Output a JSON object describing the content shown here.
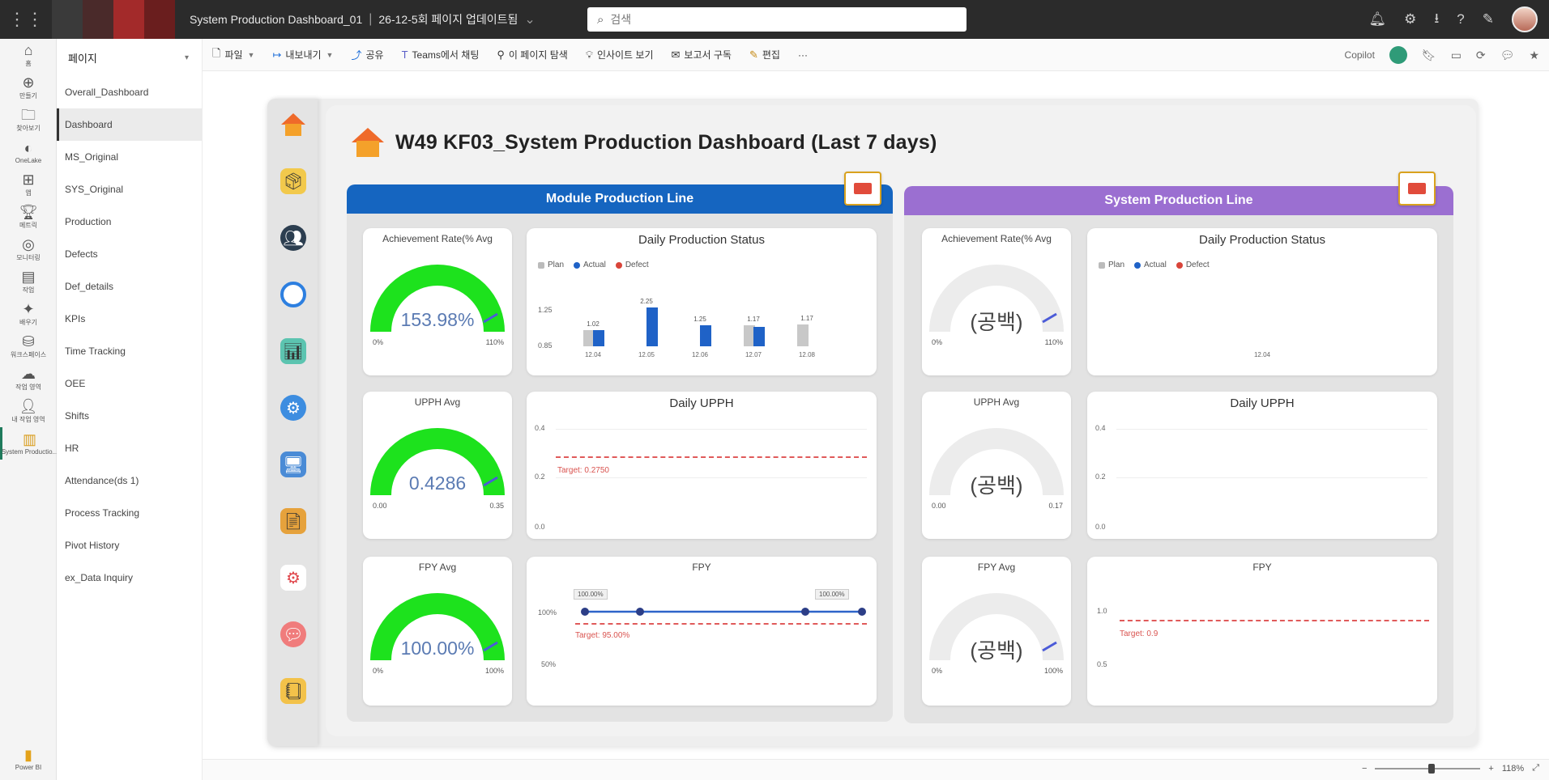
{
  "titlebar": {
    "app_title": "System Production Dashboard_01",
    "crumb": "26-12-5회 페이지 업데이트됨",
    "search_placeholder": "검색"
  },
  "rail": {
    "items": [
      {
        "label": "홈",
        "icon": "home-icon"
      },
      {
        "label": "만들기",
        "icon": "create-icon"
      },
      {
        "label": "찾아보기",
        "icon": "browse-icon"
      },
      {
        "label": "OneLake",
        "icon": "onelake-icon"
      },
      {
        "label": "앱",
        "icon": "apps-icon"
      },
      {
        "label": "메트릭",
        "icon": "metrics-icon"
      },
      {
        "label": "모니터링",
        "icon": "monitor-icon"
      },
      {
        "label": "작업",
        "icon": "workspaces-icon"
      },
      {
        "label": "배우기",
        "icon": "learn-icon"
      },
      {
        "label": "워크스페이스",
        "icon": "workspace-icon"
      },
      {
        "label": "작업 영역",
        "icon": "workspace-area-icon"
      },
      {
        "label": "내 작업 영역",
        "icon": "my-workspace-icon"
      },
      {
        "label": "System Productio...",
        "icon": "report-icon"
      }
    ],
    "bottom_label": "Power BI"
  },
  "pages": {
    "header": "페이지",
    "items": [
      "Overall_Dashboard",
      "Dashboard",
      "MS_Original",
      "SYS_Original",
      "Production",
      "Defects",
      "Def_details",
      "KPIs",
      "Time Tracking",
      "OEE",
      "Shifts",
      "HR",
      "Attendance(ds 1)",
      "Process Tracking",
      "Pivot History",
      "ex_Data Inquiry"
    ],
    "active_index": 1
  },
  "toolbar": {
    "items": [
      "파일",
      "내보내기",
      "공유",
      "Teams에서 채팅",
      "이 페이지 탐색",
      "인사이트 보기",
      "보고서 구독",
      "편집",
      "···"
    ],
    "copilot": "Copilot"
  },
  "status": {
    "zoom": "118%"
  },
  "report": {
    "title": "W49  KF03_System Production Dashboard  (Last 7 days)",
    "module": {
      "header": "Module Production Line",
      "color": "#1565c0",
      "achievement": {
        "title": "Achievement Rate(% Avg",
        "value": "153.98%",
        "min": "0%",
        "max": "110%",
        "fraction": 1.0
      },
      "daily_status": {
        "title": "Daily Production Status",
        "legend": [
          "Plan",
          "Actual",
          "Defect"
        ],
        "yticks": [
          "1.25",
          "0.85"
        ],
        "categories": [
          "12.04",
          "12.05",
          "12.06",
          "12.07",
          "12.08"
        ],
        "plan": [
          0.9,
          0,
          0,
          1.2,
          1.25
        ],
        "actual": [
          0.9,
          2.2,
          1.2,
          1.1,
          0
        ],
        "labels": [
          "1.02",
          "2.25",
          "1.25",
          "1.17",
          "1.17"
        ]
      },
      "uppm": {
        "title": "UPPH Avg",
        "value": "0.4286",
        "min": "0.00",
        "max": "0.35",
        "fraction": 1.0
      },
      "daily_uppm": {
        "title": "Daily UPPH",
        "yticks": [
          "0.4",
          "0.2",
          "0.0"
        ],
        "target": "Target: 0.2750"
      },
      "fpy": {
        "title": "FPY Avg",
        "value": "100.00%",
        "min": "0%",
        "max": "100%",
        "fraction": 1.0
      },
      "fpy_chart": {
        "title": "FPY",
        "yticks": [
          "100%",
          "50%"
        ],
        "target": "Target: 95.00%",
        "labels": [
          "100.00%",
          "100.00%"
        ]
      }
    },
    "system": {
      "header": "System Production Line",
      "color": "#9b6fd1",
      "achievement": {
        "title": "Achievement Rate(% Avg",
        "value": "(공백)",
        "min": "0%",
        "max": "110%"
      },
      "daily_status": {
        "title": "Daily Production Status",
        "legend": [
          "Plan",
          "Actual",
          "Defect"
        ],
        "category": "12.04"
      },
      "uppm": {
        "title": "UPPH Avg",
        "value": "(공백)",
        "min": "0.00",
        "max": "0.17"
      },
      "daily_uppm": {
        "title": "Daily UPPH",
        "yticks": [
          "0.4",
          "0.2",
          "0.0"
        ]
      },
      "fpy": {
        "title": "FPY Avg",
        "value": "(공백)",
        "min": "0%",
        "max": "100%"
      },
      "fpy_chart": {
        "title": "FPY",
        "yticks": [
          "1.0",
          "0.5"
        ],
        "target": "Target: 0.9"
      }
    }
  }
}
